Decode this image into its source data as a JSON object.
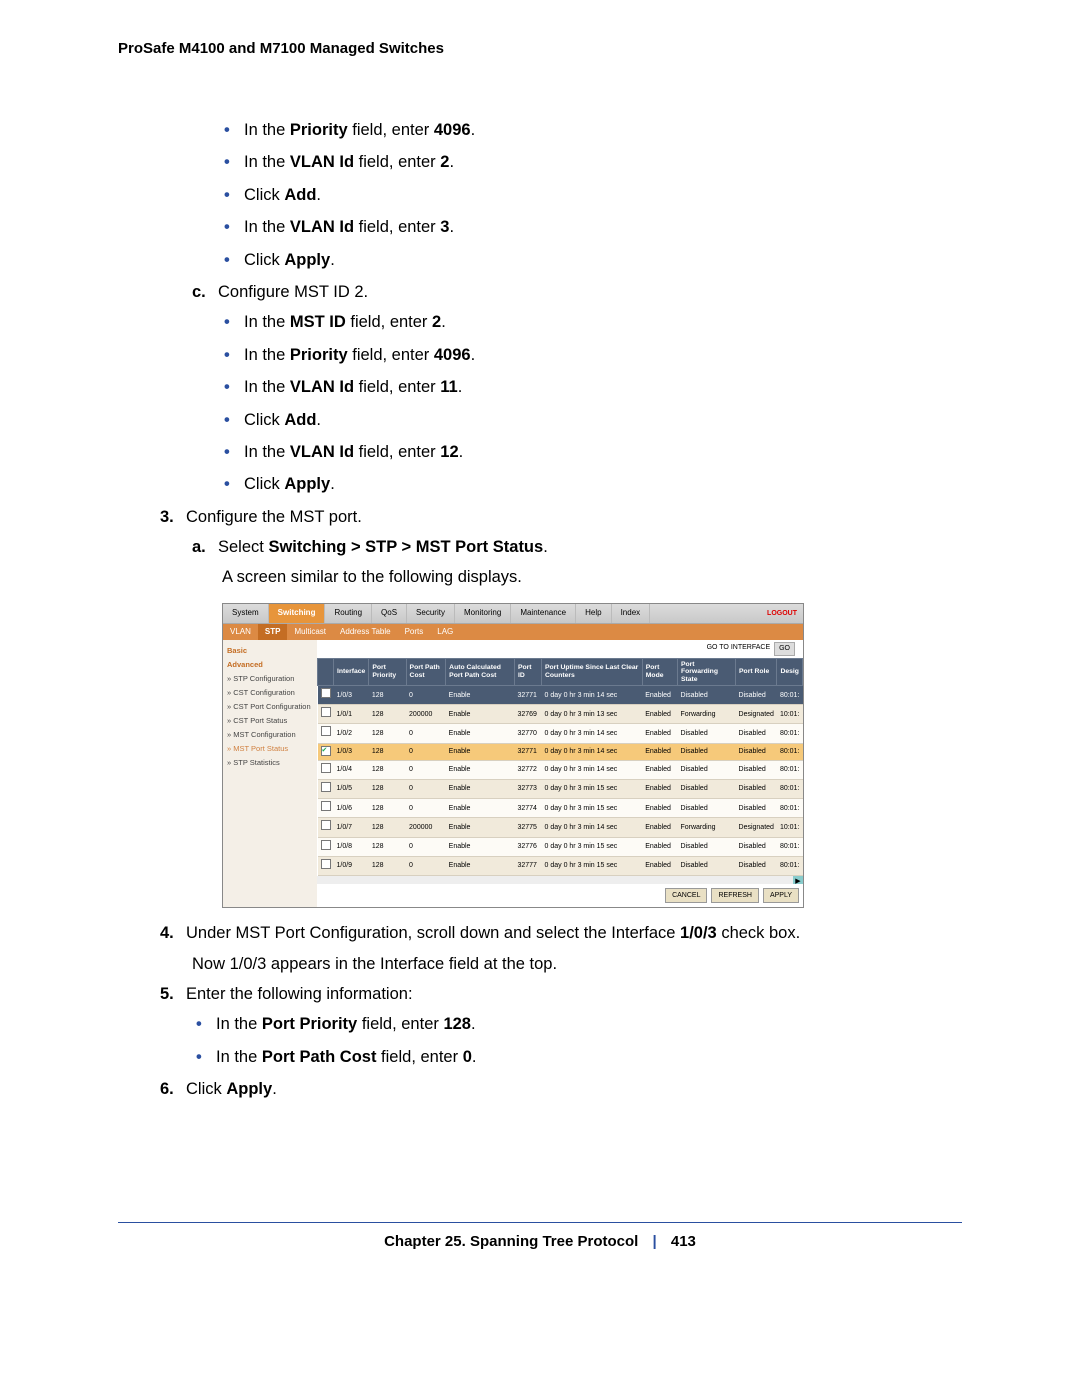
{
  "header": {
    "title": "ProSafe M4100 and M7100 Managed Switches"
  },
  "instructions": {
    "b1": "In the ",
    "b1_bold": "Priority",
    "b1_cont": " field, enter ",
    "b1_val": "4096",
    "b1_end": ".",
    "b2": "In the ",
    "b2_bold": "VLAN Id",
    "b2_cont": " field, enter ",
    "b2_val": "2",
    "b2_end": ".",
    "b3": "Click ",
    "b3_bold": "Add",
    "b3_end": ".",
    "b4": "In the ",
    "b4_bold": "VLAN Id",
    "b4_cont": " field, enter ",
    "b4_val": "3",
    "b4_end": ".",
    "b5": "Click ",
    "b5_bold": "Apply",
    "b5_end": ".",
    "c_marker": "c.",
    "c_text": "Configure MST ID 2.",
    "c1": "In the ",
    "c1_bold": "MST ID",
    "c1_cont": " field, enter ",
    "c1_val": "2",
    "c1_end": ".",
    "c2": "In the ",
    "c2_bold": "Priority",
    "c2_cont": " field, enter ",
    "c2_val": "4096",
    "c2_end": ".",
    "c3": "In the ",
    "c3_bold": "VLAN Id",
    "c3_cont": " field, enter ",
    "c3_val": "11",
    "c3_end": ".",
    "c4": "Click ",
    "c4_bold": "Add",
    "c4_end": ".",
    "c5": "In the ",
    "c5_bold": "VLAN Id",
    "c5_cont": " field, enter ",
    "c5_val": "12",
    "c5_end": ".",
    "c6": "Click ",
    "c6_bold": "Apply",
    "c6_end": ".",
    "n3_marker": "3.",
    "n3_text": "Configure the MST port.",
    "a_marker": "a.",
    "a_pre": "Select ",
    "a_bold": "Switching > STP > MST Port Status",
    "a_end": ".",
    "a_follow": "A screen similar to the following displays.",
    "n4_marker": "4.",
    "n4_pre": "Under MST Port Configuration, scroll down and select the Interface ",
    "n4_bold": "1/0/3",
    "n4_end": " check box.",
    "n4_follow": "Now 1/0/3 appears in the Interface field at the top.",
    "n5_marker": "5.",
    "n5_text": "Enter the following information:",
    "n5b1": "In the ",
    "n5b1_bold": "Port Priority",
    "n5b1_cont": " field, enter ",
    "n5b1_val": "128",
    "n5b1_end": ".",
    "n5b2": "In the ",
    "n5b2_bold": "Port Path Cost",
    "n5b2_cont": " field, enter ",
    "n5b2_val": "0",
    "n5b2_end": ".",
    "n6_marker": "6.",
    "n6_pre": "Click ",
    "n6_bold": "Apply",
    "n6_end": "."
  },
  "ui": {
    "tabs": [
      "System",
      "Switching",
      "Routing",
      "QoS",
      "Security",
      "Monitoring",
      "Maintenance",
      "Help",
      "Index"
    ],
    "active_tab": "Switching",
    "logout": "LOGOUT",
    "subtabs": [
      "VLAN",
      "STP",
      "Multicast",
      "Address Table",
      "Ports",
      "LAG"
    ],
    "active_subtab": "STP",
    "sidebar": {
      "basic": "Basic",
      "advanced": "Advanced",
      "items": [
        "» STP Configuration",
        "» CST Configuration",
        "» CST Port Configuration",
        "» CST Port Status",
        "» MST Configuration",
        "» MST Port Status",
        "» STP Statistics"
      ],
      "active": "» MST Port Status"
    },
    "go": {
      "label": "GO TO INTERFACE",
      "btn": "GO"
    },
    "columns": [
      "",
      "Interface",
      "Port Priority",
      "Port Path Cost",
      "Auto Calculated Port Path Cost",
      "Port ID",
      "Port Uptime Since Last Clear Counters",
      "Port Mode",
      "Port Forwarding State",
      "Port Role",
      "Desig"
    ],
    "rows": [
      {
        "sel": false,
        "iface": "1/0/3",
        "prio": "128",
        "cost": "0",
        "auto": "Enable",
        "pid": "32771",
        "uptime": "0 day 0 hr 3 min 14 sec",
        "mode": "Enabled",
        "fwd": "Disabled",
        "role": "Disabled",
        "desig": "80:01:",
        "cls": "row-input"
      },
      {
        "sel": false,
        "iface": "1/0/1",
        "prio": "128",
        "cost": "200000",
        "auto": "Enable",
        "pid": "32769",
        "uptime": "0 day 0 hr 3 min 13 sec",
        "mode": "Enabled",
        "fwd": "Forwarding",
        "role": "Designated",
        "desig": "10:01:",
        "cls": "row-alt"
      },
      {
        "sel": false,
        "iface": "1/0/2",
        "prio": "128",
        "cost": "0",
        "auto": "Enable",
        "pid": "32770",
        "uptime": "0 day 0 hr 3 min 14 sec",
        "mode": "Enabled",
        "fwd": "Disabled",
        "role": "Disabled",
        "desig": "80:01:",
        "cls": "row-plain"
      },
      {
        "sel": true,
        "iface": "1/0/3",
        "prio": "128",
        "cost": "0",
        "auto": "Enable",
        "pid": "32771",
        "uptime": "0 day 0 hr 3 min 14 sec",
        "mode": "Enabled",
        "fwd": "Disabled",
        "role": "Disabled",
        "desig": "80:01:",
        "cls": "row-sel"
      },
      {
        "sel": false,
        "iface": "1/0/4",
        "prio": "128",
        "cost": "0",
        "auto": "Enable",
        "pid": "32772",
        "uptime": "0 day 0 hr 3 min 14 sec",
        "mode": "Enabled",
        "fwd": "Disabled",
        "role": "Disabled",
        "desig": "80:01:",
        "cls": "row-plain"
      },
      {
        "sel": false,
        "iface": "1/0/5",
        "prio": "128",
        "cost": "0",
        "auto": "Enable",
        "pid": "32773",
        "uptime": "0 day 0 hr 3 min 15 sec",
        "mode": "Enabled",
        "fwd": "Disabled",
        "role": "Disabled",
        "desig": "80:01:",
        "cls": "row-alt"
      },
      {
        "sel": false,
        "iface": "1/0/6",
        "prio": "128",
        "cost": "0",
        "auto": "Enable",
        "pid": "32774",
        "uptime": "0 day 0 hr 3 min 15 sec",
        "mode": "Enabled",
        "fwd": "Disabled",
        "role": "Disabled",
        "desig": "80:01:",
        "cls": "row-plain"
      },
      {
        "sel": false,
        "iface": "1/0/7",
        "prio": "128",
        "cost": "200000",
        "auto": "Enable",
        "pid": "32775",
        "uptime": "0 day 0 hr 3 min 14 sec",
        "mode": "Enabled",
        "fwd": "Forwarding",
        "role": "Designated",
        "desig": "10:01:",
        "cls": "row-alt"
      },
      {
        "sel": false,
        "iface": "1/0/8",
        "prio": "128",
        "cost": "0",
        "auto": "Enable",
        "pid": "32776",
        "uptime": "0 day 0 hr 3 min 15 sec",
        "mode": "Enabled",
        "fwd": "Disabled",
        "role": "Disabled",
        "desig": "80:01:",
        "cls": "row-plain"
      },
      {
        "sel": false,
        "iface": "1/0/9",
        "prio": "128",
        "cost": "0",
        "auto": "Enable",
        "pid": "32777",
        "uptime": "0 day 0 hr 3 min 15 sec",
        "mode": "Enabled",
        "fwd": "Disabled",
        "role": "Disabled",
        "desig": "80:01:",
        "cls": "row-alt"
      }
    ],
    "buttons": {
      "cancel": "CANCEL",
      "refresh": "REFRESH",
      "apply": "APPLY"
    }
  },
  "footer": {
    "chapter": "Chapter 25.  Spanning Tree Protocol",
    "page": "413"
  }
}
